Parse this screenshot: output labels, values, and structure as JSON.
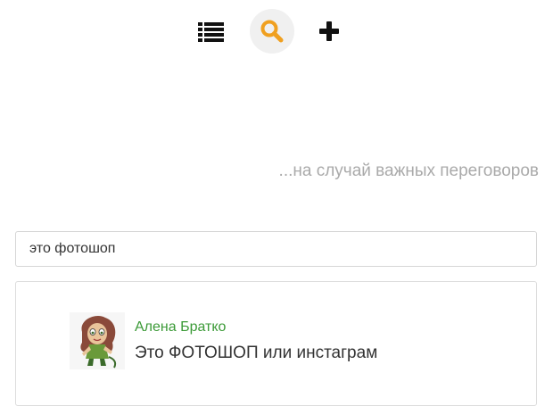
{
  "toolbar": {
    "list_icon": "list-icon",
    "search_icon": "search-icon",
    "add_icon": "plus-icon",
    "accent_color": "#f0a020"
  },
  "tagline": "...на случай важных переговоров",
  "search": {
    "value": "это фотошоп"
  },
  "results": [
    {
      "author": "Алена Братко",
      "message": "Это ФОТОШОП или инстаграм",
      "author_color": "#3b9a37"
    }
  ]
}
